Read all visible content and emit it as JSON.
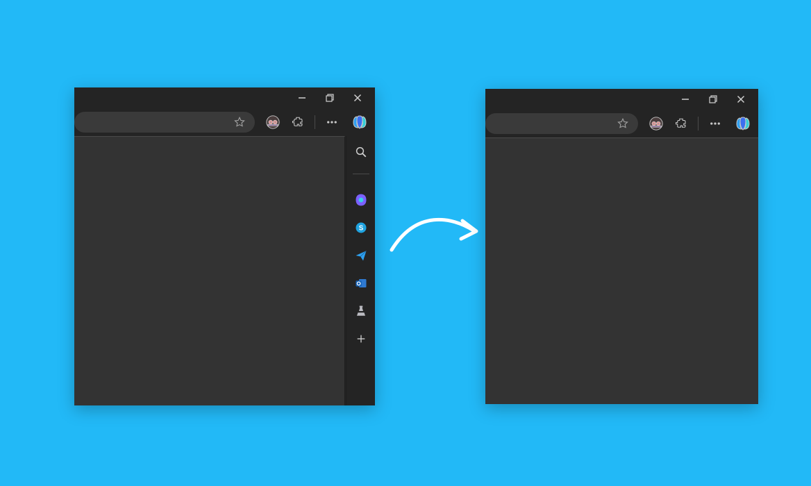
{
  "leftWindow": {
    "titlebar": {
      "minimize": "minimize",
      "maximize": "maximize",
      "close": "close"
    },
    "toolbar": {
      "favorite": "favorite-star",
      "profile": "profile-avatar",
      "extensions": "extensions",
      "menu": "settings-and-more",
      "copilot": "copilot"
    },
    "sidebar": {
      "search": "search",
      "microsoft365": "microsoft-365",
      "skype": "skype",
      "send": "send",
      "outlook": "outlook",
      "games": "games",
      "add": "add"
    }
  },
  "rightWindow": {
    "titlebar": {
      "minimize": "minimize",
      "maximize": "maximize",
      "close": "close"
    },
    "toolbar": {
      "favorite": "favorite-star",
      "profile": "profile-avatar",
      "extensions": "extensions",
      "menu": "settings-and-more",
      "copilot": "copilot"
    }
  },
  "transition_arrow": "before-to-after"
}
